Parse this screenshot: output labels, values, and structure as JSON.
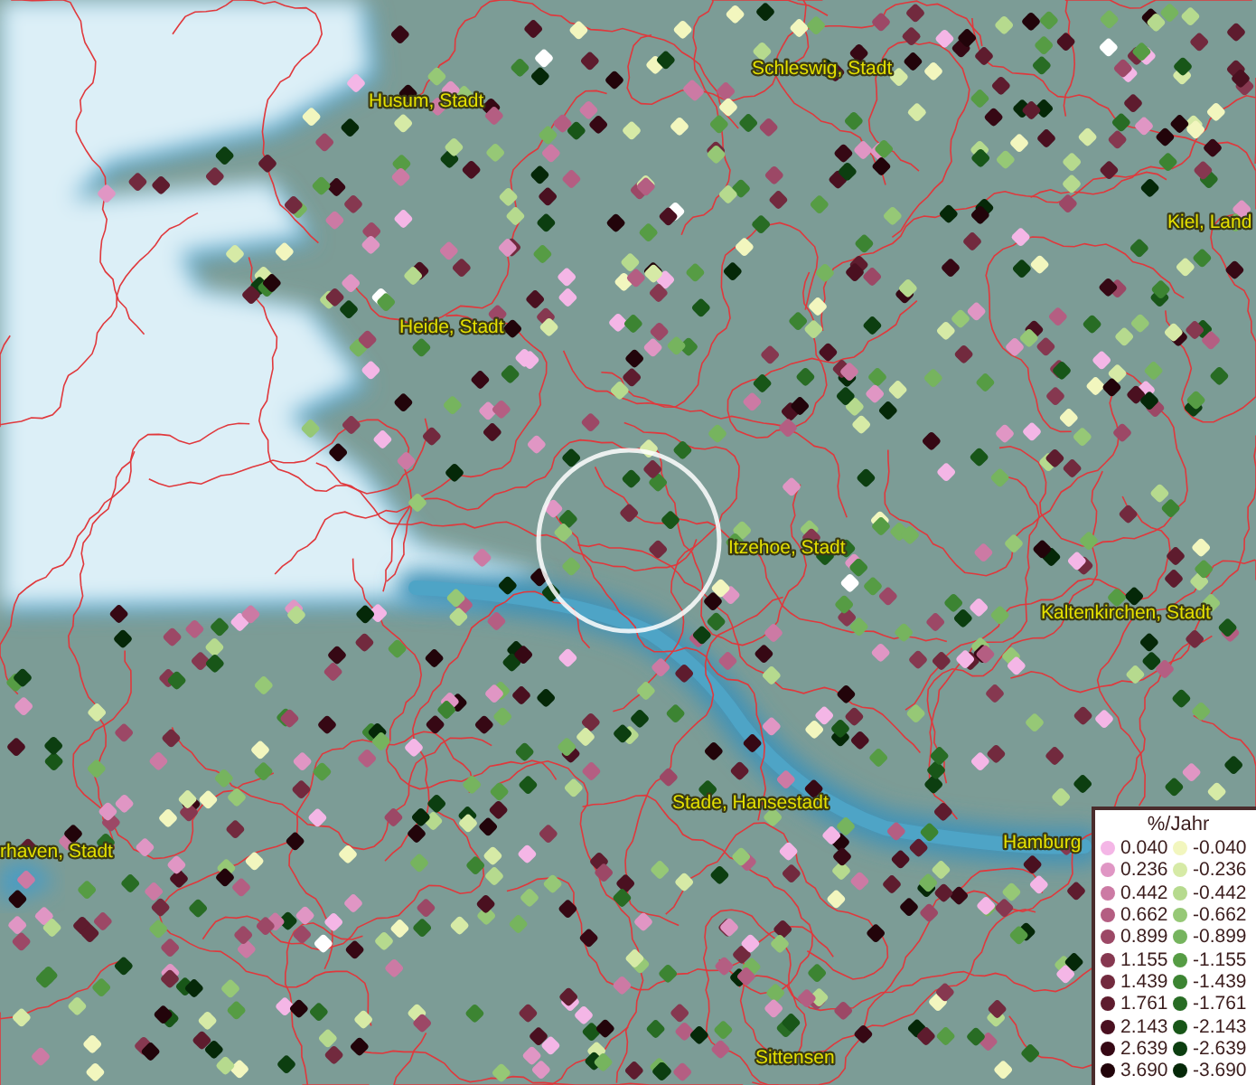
{
  "map": {
    "labels": [
      {
        "text": "Schleswig, Stadt"
      },
      {
        "text": "Husum, Stadt"
      },
      {
        "text": "Kiel, Land"
      },
      {
        "text": "Heide, Stadt"
      },
      {
        "text": "Itzehoe, Stadt"
      },
      {
        "text": "Kaltenkirchen, Stadt"
      },
      {
        "text": "Stade, Hansestadt"
      },
      {
        "text": "rhaven, Stadt"
      },
      {
        "text": "Hamburg"
      },
      {
        "text": "Sittensen"
      }
    ]
  },
  "legend": {
    "title": "%/Jahr",
    "positive": [
      {
        "label": "0.040",
        "color": "#f4b6e6"
      },
      {
        "label": "0.236",
        "color": "#e096c4"
      },
      {
        "label": "0.442",
        "color": "#cc7aa4"
      },
      {
        "label": "0.662",
        "color": "#b45e82"
      },
      {
        "label": "0.899",
        "color": "#9c4866"
      },
      {
        "label": "1.155",
        "color": "#863850"
      },
      {
        "label": "1.439",
        "color": "#722a3e"
      },
      {
        "label": "1.761",
        "color": "#5e1c2e"
      },
      {
        "label": "2.143",
        "color": "#4a1020"
      },
      {
        "label": "2.639",
        "color": "#360814"
      },
      {
        "label": "3.690",
        "color": "#22040a"
      }
    ],
    "negative": [
      {
        "label": "-0.040",
        "color": "#f2f6be"
      },
      {
        "label": "-0.236",
        "color": "#d6eaa6"
      },
      {
        "label": "-0.442",
        "color": "#b6da8e"
      },
      {
        "label": "-0.662",
        "color": "#96c876"
      },
      {
        "label": "-0.899",
        "color": "#76b45e"
      },
      {
        "label": "-1.155",
        "color": "#569c44"
      },
      {
        "label": "-1.439",
        "color": "#3c8432"
      },
      {
        "label": "-1.761",
        "color": "#286c24"
      },
      {
        "label": "-2.143",
        "color": "#185618"
      },
      {
        "label": "-2.639",
        "color": "#0c3e10"
      },
      {
        "label": "-3.690",
        "color": "#052808"
      }
    ]
  }
}
